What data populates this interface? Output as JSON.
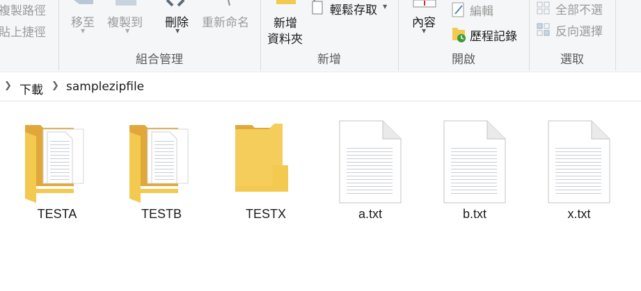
{
  "ribbon": {
    "clipboard": {
      "copy_path": "複製路徑",
      "paste_shortcut": "貼上捷徑"
    },
    "organize": {
      "move_to": "移至",
      "copy_to": "複製到",
      "delete": "刪除",
      "rename": "重新命名",
      "group_label": "組合管理"
    },
    "new": {
      "new_folder_line1": "新增",
      "new_folder_line2": "資料夾",
      "easy_access": "輕鬆存取",
      "group_label": "新增"
    },
    "open": {
      "properties": "內容",
      "edit": "編輯",
      "history": "歷程記錄",
      "group_label": "開啟"
    },
    "select": {
      "select_none": "全部不選",
      "invert_selection": "反向選擇",
      "group_label": "選取"
    }
  },
  "breadcrumb": {
    "items": [
      "下載",
      "samplezipfile"
    ]
  },
  "files": [
    {
      "name": "TESTA",
      "type": "folder-with-documents"
    },
    {
      "name": "TESTB",
      "type": "folder-with-documents"
    },
    {
      "name": "TESTX",
      "type": "folder"
    },
    {
      "name": "a.txt",
      "type": "text-file"
    },
    {
      "name": "b.txt",
      "type": "text-file"
    },
    {
      "name": "x.txt",
      "type": "text-file"
    }
  ],
  "colors": {
    "folder": "#f3c94f",
    "folder_back": "#e0a83a",
    "ribbon_bg": "#f5f6f7",
    "disabled_text": "#9a9a9a"
  }
}
